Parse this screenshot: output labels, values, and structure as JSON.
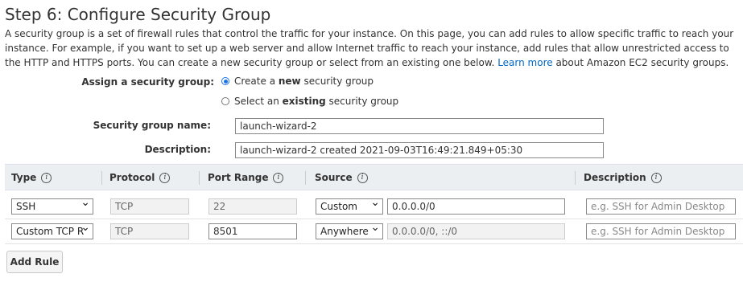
{
  "page": {
    "title": "Step 6: Configure Security Group",
    "intro_text": "A security group is a set of firewall rules that control the traffic for your instance. On this page, you can add rules to allow specific traffic to reach your instance. For example, if you want to set up a web server and allow Internet traffic to reach your instance, add rules that allow unrestricted access to the HTTP and HTTPS ports. You can create a new security group or select from an existing one below.",
    "learn_more": "Learn more",
    "intro_tail": "about Amazon EC2 security groups."
  },
  "assign": {
    "label": "Assign a security group:",
    "option_create": {
      "pre": "Create a ",
      "bold": "new",
      "post": " security group",
      "selected": true
    },
    "option_existing": {
      "pre": "Select an ",
      "bold": "existing",
      "post": " security group",
      "selected": false
    }
  },
  "form": {
    "name_label": "Security group name:",
    "name_value": "launch-wizard-2",
    "desc_label": "Description:",
    "desc_value": "launch-wizard-2 created 2021-09-03T16:49:21.849+05:30"
  },
  "table": {
    "headers": [
      "Type",
      "Protocol",
      "Port Range",
      "Source",
      "Description"
    ],
    "rows": [
      {
        "type": "SSH",
        "protocol": "TCP",
        "port": "22",
        "source_sel": "Custom",
        "source_val": "0.0.0.0/0",
        "desc_placeholder": "e.g. SSH for Admin Desktop"
      },
      {
        "type": "Custom TCP R",
        "protocol": "TCP",
        "port": "8501",
        "source_sel": "Anywhere",
        "source_val": "0.0.0.0/0, ::/0",
        "desc_placeholder": "e.g. SSH for Admin Desktop"
      }
    ]
  },
  "actions": {
    "add_rule": "Add Rule"
  },
  "icons": {
    "info": "info-icon",
    "dropdown": "chevron-down-icon"
  },
  "colors": {
    "link": "#0066c0",
    "radio_selected": "#1a73e8",
    "header_bg": "#eceff1"
  }
}
